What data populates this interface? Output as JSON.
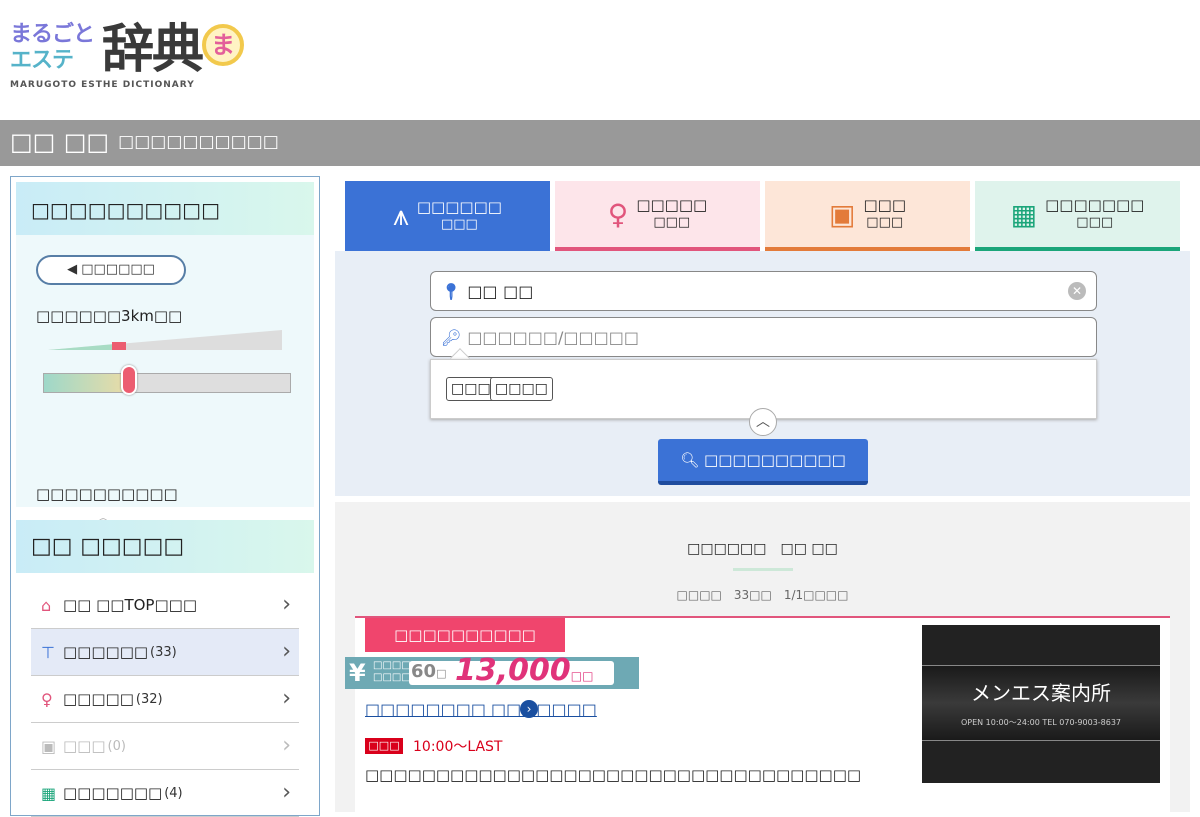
{
  "header": {
    "logo_line1": "まるごと",
    "logo_line2": "エステ",
    "logo_big": "辞典",
    "logo_badge": "ま",
    "logo_en": "MARUGOTO ESTHE DICTIONARY",
    "area": "□□ □□",
    "subtitle": "□□□□□□□□□□"
  },
  "sidebar": {
    "panel1_title": "□□□□□□□□□□",
    "current_btn": "□□□□□□",
    "range_text": "□□□□□□3km□□",
    "spec_label": "□□□□□□□□□□",
    "spec_link": "□□□□□□□□□□□□□",
    "panel2_title": "□□ □□□□□",
    "menu": [
      {
        "label": "□□ □□TOP□□□",
        "count": "",
        "icon": "home-icon"
      },
      {
        "label": "□□□□□□",
        "count": "(33)",
        "icon": "hanger-icon"
      },
      {
        "label": "□□□□□",
        "count": "(32)",
        "icon": "girl-icon"
      },
      {
        "label": "□□□",
        "count": "(0)",
        "icon": "chat-icon"
      },
      {
        "label": "□□□□□□□",
        "count": "(4)",
        "icon": "calendar-icon"
      }
    ]
  },
  "tabs": [
    {
      "label": "□□□□□□",
      "sub": "□□□"
    },
    {
      "label": "□□□□□",
      "sub": "□□□"
    },
    {
      "label": "□□□",
      "sub": "□□□"
    },
    {
      "label": "□□□□□□□",
      "sub": "□□□"
    }
  ],
  "search": {
    "location_value": "□□ □□",
    "keyword_placeholder": "□□□□□□/□□□□□",
    "chips": [
      "□□□",
      "□□□□"
    ],
    "button_label": "□□□□□□□□□□"
  },
  "results": {
    "title": "□□□□□□　□□ □□",
    "meta": "□□□□　33□□　1/1□□□□",
    "card": {
      "label": "□□□□□□□□□□",
      "price_label": "□□□□\n□□□□",
      "minutes": "60",
      "min_unit": "□",
      "price": "13,000",
      "price_unit": "□□",
      "shop_name": "□□□□□□□□ □□□□□□□",
      "status": "□□□",
      "hours": "10:00～LAST",
      "description": "□□□□□□□□□□□□□□□□□□□□□□□□□□□□□□□□□□□",
      "image_title": "メンエス案内所",
      "image_tagline": "OPEN 10:00〜24:00  TEL 070-9003-8637"
    }
  },
  "colors": {
    "accent_blue": "#3b72d6",
    "header_gray": "#999999",
    "pink": "#f0456d",
    "price_pink": "#e0337a",
    "status_red": "#d9001b"
  }
}
